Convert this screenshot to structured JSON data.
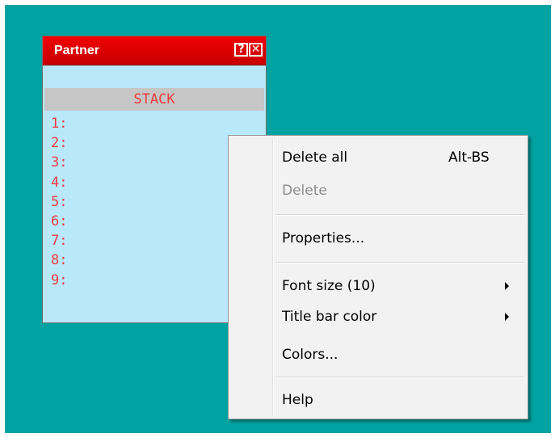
{
  "partner_window": {
    "title": "Partner",
    "help_button": "?",
    "close_button": "✕",
    "stack_header": "STACK",
    "stack_levels": [
      "1:",
      "2:",
      "3:",
      "4:",
      "5:",
      "6:",
      "7:",
      "8:",
      "9:"
    ]
  },
  "context_menu": {
    "delete_all": {
      "label": "Delete all",
      "shortcut": "Alt-BS"
    },
    "delete": {
      "label": "Delete",
      "enabled": false
    },
    "properties": {
      "label": "Properties..."
    },
    "font_size": {
      "label": "Font size (10)"
    },
    "title_bar_color": {
      "label": "Title bar color"
    },
    "colors": {
      "label": "Colors..."
    },
    "help": {
      "label": "Help"
    }
  },
  "colors": {
    "desktop": "#00a2a2",
    "title_bar": "#e00000",
    "window_background": "#b8e8fa",
    "stack_text": "#f03c3c",
    "menu_background": "#f2f2f2"
  }
}
